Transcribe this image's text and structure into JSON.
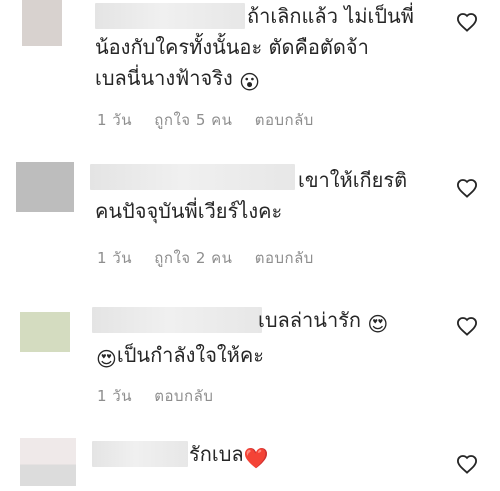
{
  "comments": [
    {
      "lines": [
        "ถ้าเลิกแล้ว ไม่เป็นพี่",
        "น้องกับใครทั้งนั้นอะ ตัดคือตัดจ้า",
        "เบลนี่นางฟ้าจริง"
      ],
      "emoji_end": "😮",
      "time": "1 วัน",
      "likes": "ถูกใจ 5 คน",
      "reply": "ตอบกลับ"
    },
    {
      "lines": [
        "เขาให้เกียรติ",
        "คนปัจจุบันพี่เวียร์ไงคะ"
      ],
      "time": "1 วัน",
      "likes": "ถูกใจ 2 คน",
      "reply": "ตอบกลับ"
    },
    {
      "lines": [
        "เบลล่าน่ารัก",
        "เป็นกำลังใจให้คะ"
      ],
      "emoji_line1_end": "😍",
      "emoji_line2_start": "😍",
      "time": "1 วัน",
      "reply": "ตอบกลับ"
    },
    {
      "lines": [
        "รักเบล"
      ],
      "emoji_end": "❤️"
    }
  ],
  "icons": {
    "like": "heart-outline-icon"
  },
  "colors": {
    "text": "#262626",
    "meta": "#8e8e8e",
    "heart_emoji": "#d9132c"
  }
}
